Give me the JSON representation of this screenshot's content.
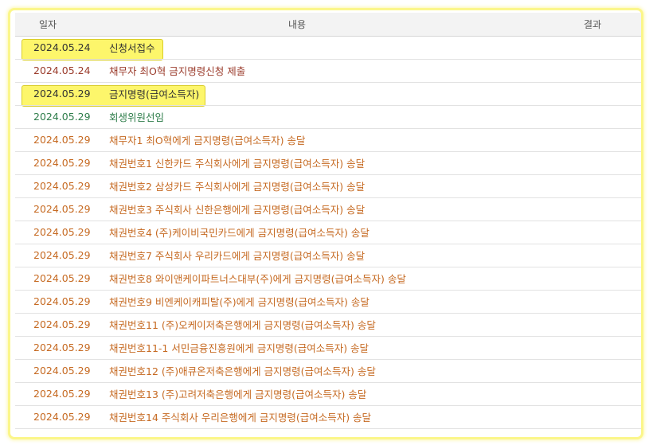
{
  "header": {
    "date": "일자",
    "content": "내용",
    "result": "결과"
  },
  "rows": [
    {
      "date": "2024.05.24",
      "content": "신청서접수",
      "result": ""
    },
    {
      "date": "2024.05.24",
      "content": "채무자 최O혁 금지명령신청 제출",
      "result": ""
    },
    {
      "date": "2024.05.29",
      "content": "금지명령(급여소득자)",
      "result": ""
    },
    {
      "date": "2024.05.29",
      "content": "회생위원선임",
      "result": ""
    },
    {
      "date": "2024.05.29",
      "content": "채무자1 최O혁에게 금지명령(급여소득자) 송달",
      "result": ""
    },
    {
      "date": "2024.05.29",
      "content": "채권번호1 신한카드 주식회사에게 금지명령(급여소득자) 송달",
      "result": ""
    },
    {
      "date": "2024.05.29",
      "content": "채권번호2 삼성카드 주식회사에게 금지명령(급여소득자) 송달",
      "result": ""
    },
    {
      "date": "2024.05.29",
      "content": "채권번호3 주식회사 신한은행에게 금지명령(급여소득자) 송달",
      "result": ""
    },
    {
      "date": "2024.05.29",
      "content": "채권번호4 (주)케이비국민카드에게 금지명령(급여소득자) 송달",
      "result": ""
    },
    {
      "date": "2024.05.29",
      "content": "채권번호7 주식회사 우리카드에게 금지명령(급여소득자) 송달",
      "result": ""
    },
    {
      "date": "2024.05.29",
      "content": "채권번호8 와이앤케이파트너스대부(주)에게 금지명령(급여소득자) 송달",
      "result": ""
    },
    {
      "date": "2024.05.29",
      "content": "채권번호9 비엔케이캐피탈(주)에게 금지명령(급여소득자) 송달",
      "result": ""
    },
    {
      "date": "2024.05.29",
      "content": "채권번호11 (주)오케이저축은행에게 금지명령(급여소득자) 송달",
      "result": ""
    },
    {
      "date": "2024.05.29",
      "content": "채권번호11-1 서민금융진흥원에게 금지명령(급여소득자) 송달",
      "result": ""
    },
    {
      "date": "2024.05.29",
      "content": "채권번호12 (주)애큐온저축은행에게 금지명령(급여소득자) 송달",
      "result": ""
    },
    {
      "date": "2024.05.29",
      "content": "채권번호13 (주)고려저축은행에게 금지명령(급여소득자) 송달",
      "result": ""
    },
    {
      "date": "2024.05.29",
      "content": "채권번호14 주식회사 우리은행에게 금지명령(급여소득자) 송달",
      "result": ""
    }
  ],
  "colors": {
    "highlight": "#fdf66b",
    "frame_glow": "#fbf68a",
    "text_orange": "#c66a22",
    "text_maroon": "#9a3a2a",
    "text_green": "#2e7d4a",
    "header_bg": "#f3f3f3"
  }
}
